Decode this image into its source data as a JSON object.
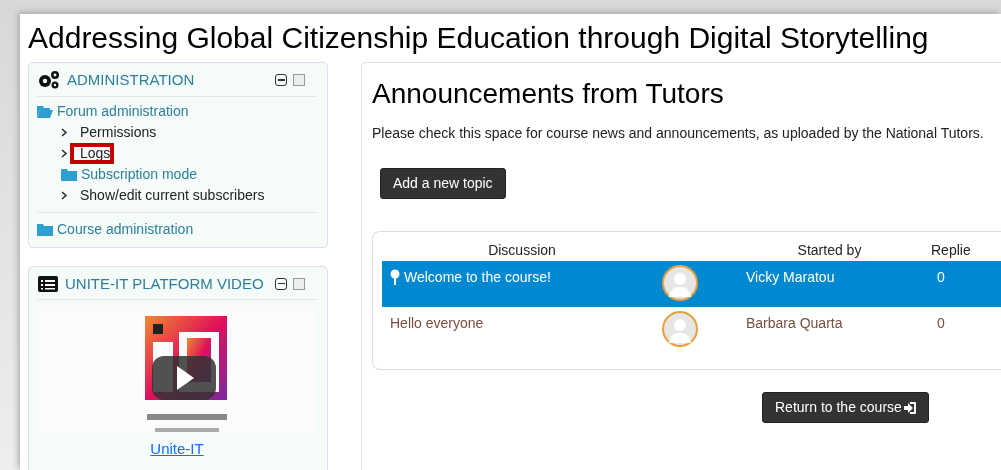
{
  "page_title": "Addressing Global Citizenship Education through Digital Storytelling",
  "admin_block": {
    "title": "ADMINISTRATION",
    "items": [
      {
        "label": "Forum administration",
        "kind": "folder",
        "expanded": true,
        "children": [
          {
            "label": "Permissions",
            "kind": "leaf",
            "highlighted": false
          },
          {
            "label": "Logs",
            "kind": "leaf",
            "highlighted": true
          },
          {
            "label": "Subscription mode",
            "kind": "folder",
            "expanded": false,
            "highlighted": false
          },
          {
            "label": "Show/edit current subscribers",
            "kind": "leaf",
            "highlighted": false
          }
        ]
      },
      {
        "label": "Course administration",
        "kind": "folder",
        "expanded": false
      }
    ]
  },
  "video_block": {
    "title": "UNITE-IT PLATFORM VIDEO",
    "link": "Unite-IT"
  },
  "forum": {
    "title": "Announcements from Tutors",
    "intro": "Please check this space for course news and announcements, as uploaded by the National Tutors.",
    "add_button": "Add a new topic",
    "columns": {
      "discussion": "Discussion",
      "started_by": "Started by",
      "replies": "Replie"
    },
    "rows": [
      {
        "subject": "Welcome to the course!",
        "author": "Vicky Maratou",
        "replies": "0",
        "pinned": true,
        "selected": true
      },
      {
        "subject": "Hello everyone",
        "author": "Barbara Quarta",
        "replies": "0",
        "pinned": false,
        "selected": false
      }
    ],
    "return_button": "Return to the course"
  }
}
